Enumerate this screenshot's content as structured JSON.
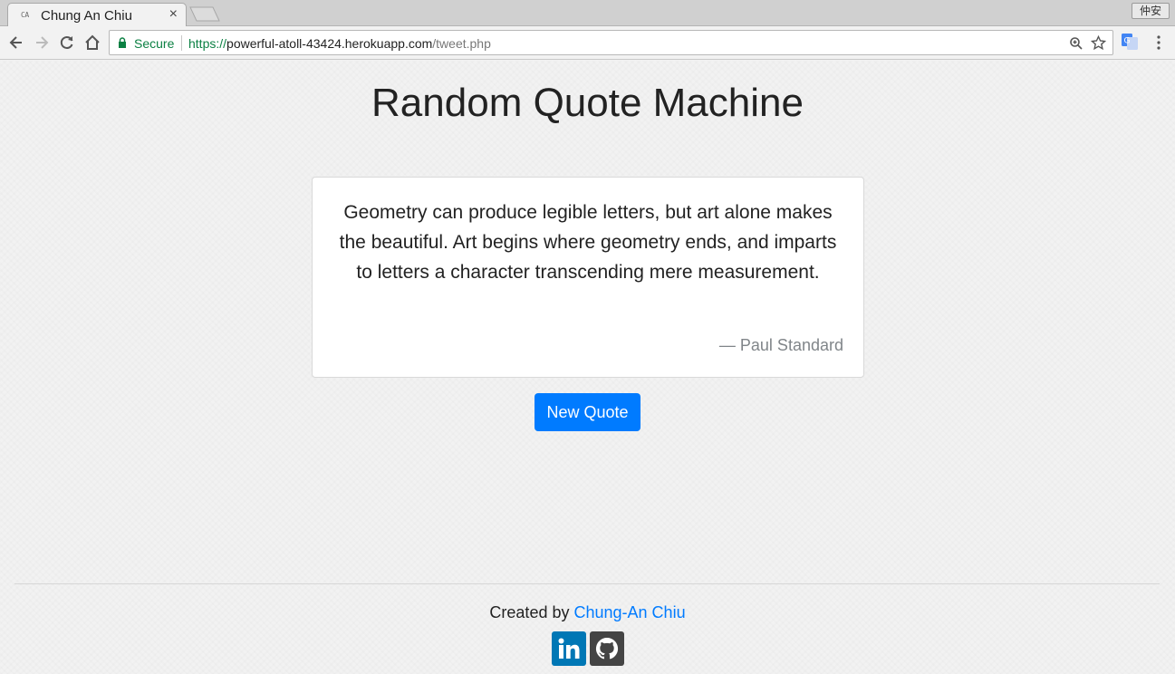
{
  "browser": {
    "tab_favicon_text": "CA",
    "tab_title": "Chung An Chiu",
    "tab_close": "×",
    "profile_label": "仲安",
    "secure_label": "Secure",
    "url_scheme": "https://",
    "url_host": "powerful-atoll-43424.herokuapp.com",
    "url_path": "/tweet.php",
    "secure_color": "#0b8043"
  },
  "page": {
    "title": "Random Quote Machine",
    "quote": "Geometry can produce legible letters, but art alone makes the beautiful. Art begins where geometry ends, and imparts to letters a character transcending mere measurement.",
    "author": "— Paul Standard",
    "new_quote_label": "New Quote",
    "accent_color": "#007bff"
  },
  "footer": {
    "created_by": "Created by",
    "author_link": "Chung-An Chiu",
    "social": [
      {
        "icon": "linkedin-icon",
        "color": "#0077b5"
      },
      {
        "icon": "github-icon",
        "color": "#444444"
      }
    ]
  }
}
